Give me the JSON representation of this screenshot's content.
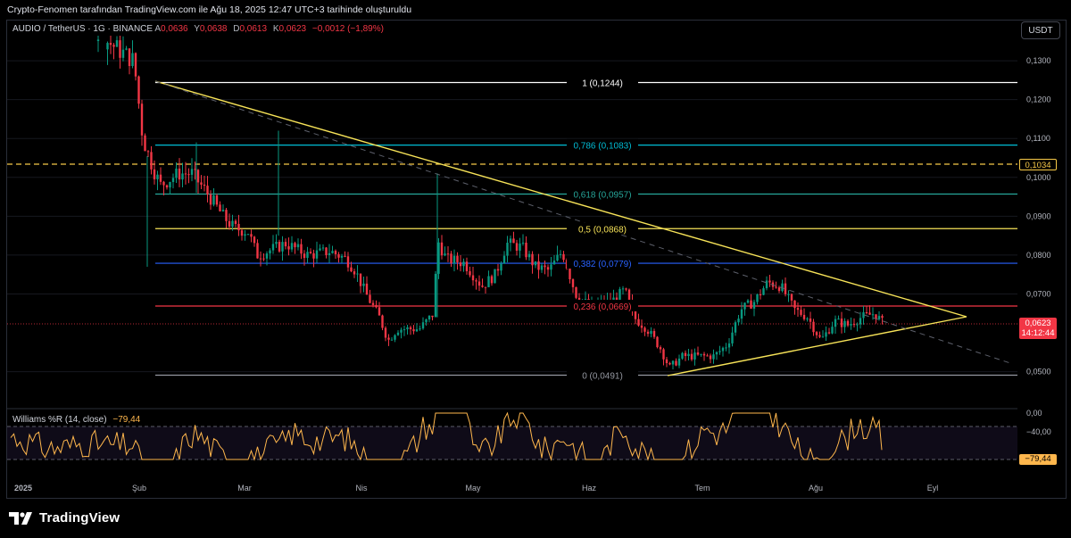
{
  "header": {
    "text": "Crypto-Fenomen tarafından TradingView.com ile Ağu 18, 2025 12:47 UTC+3 tarihinde oluşturuldu"
  },
  "symbol": {
    "name": "AUDIO / TetherUS · 1G · BINANCE",
    "open_label": "A",
    "open": "0,0636",
    "high_label": "Y",
    "high": "0,0638",
    "low_label": "D",
    "low": "0,0613",
    "close_label": "K",
    "close": "0,0623",
    "change": "−0,0012 (−1,89%)"
  },
  "currency_button": "USDT",
  "price_axis": [
    "0,1300",
    "0,1200",
    "0,1100",
    "0,1000",
    "0,0900",
    "0,0800",
    "0,0700",
    "0,0500"
  ],
  "price_tags": {
    "level": "0,1034",
    "last_price": "0,0623",
    "countdown": "14:12:44"
  },
  "fibonacci": [
    {
      "ratio": "1",
      "price": "0,1244",
      "label": "1 (0,1244)",
      "color": "#ffffff"
    },
    {
      "ratio": "0.786",
      "price": "0,1083",
      "label": "0,786 (0,1083)",
      "color": "#00bcd4"
    },
    {
      "ratio": "0.618",
      "price": "0,0957",
      "label": "0,618 (0,0957)",
      "color": "#26a69a"
    },
    {
      "ratio": "0.5",
      "price": "0,0868",
      "label": "0,5 (0,0868)",
      "color": "#f7e358"
    },
    {
      "ratio": "0.382",
      "price": "0,0779",
      "label": "0,382 (0,0779)",
      "color": "#2962ff"
    },
    {
      "ratio": "0.236",
      "price": "0,0669",
      "label": "0,236 (0,0669)",
      "color": "#f23645"
    },
    {
      "ratio": "0",
      "price": "0,0491",
      "label": "0 (0,0491)",
      "color": "#9598a1"
    }
  ],
  "time_axis": [
    "2025",
    "Şub",
    "Mar",
    "Nis",
    "May",
    "Haz",
    "Tem",
    "Ağu",
    "Eyl"
  ],
  "indicator": {
    "name": "Williams %R (14, close)",
    "value": "−79,44",
    "axis": [
      "0,00",
      "−40,00"
    ],
    "tag": "−79,44",
    "color": "#ffb74d"
  },
  "colors": {
    "up": "#089981",
    "down": "#f23645",
    "triangle": "#f7e358",
    "dashed_level": "#f7c948"
  },
  "footer": {
    "logo_icon": "tradingview-logo-icon",
    "brand": "TradingView"
  }
}
